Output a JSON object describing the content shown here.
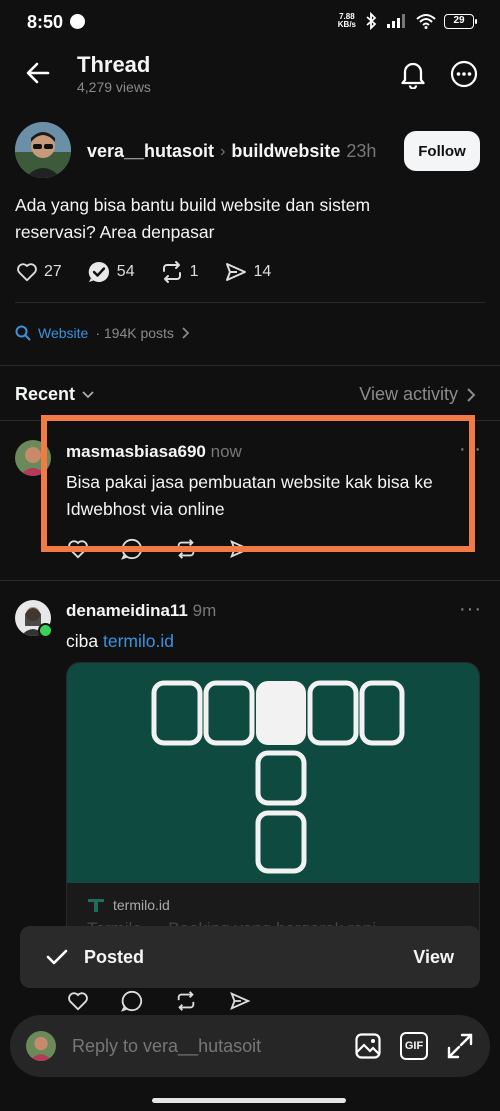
{
  "status_bar": {
    "time": "8:50",
    "net_speed": "7.88",
    "net_unit": "KB/s",
    "battery": "29"
  },
  "header": {
    "title": "Thread",
    "views": "4,279 views",
    "back_icon": "arrow-left-icon",
    "bell_icon": "bell-icon",
    "more_icon": "more-circle-icon"
  },
  "post": {
    "author": "vera__hutasoit",
    "separator": "›",
    "community": "buildwebsite",
    "time": "23h",
    "follow_label": "Follow",
    "text": "Ada yang bisa bantu build website dan sistem reservasi? Area denpasar",
    "likes": "27",
    "checks": "54",
    "reposts": "1",
    "shares": "14"
  },
  "topic": {
    "name": "Website",
    "count": "· 194K posts"
  },
  "replies_header": {
    "sort_label": "Recent",
    "activity_label": "View activity"
  },
  "replies": [
    {
      "author": "masmasbiasa690",
      "time": "now",
      "text": "Bisa pakai jasa pembuatan website kak bisa ke Idwebhost via online"
    },
    {
      "author": "denameidina11",
      "time": "9m",
      "text_prefix": "ciba ",
      "link": "termilo.id",
      "card": {
        "domain": "termilo.id",
        "title": "Termilo — Booking yang bergerak rapi"
      }
    }
  ],
  "toast": {
    "label": "Posted",
    "action": "View"
  },
  "composer": {
    "placeholder": "Reply to vera__hutasoit",
    "gif_label": "GIF"
  },
  "colors": {
    "accent_link": "#3b93e0",
    "highlight": "#f17a45",
    "card_bg": "#0e4a40",
    "online": "#3ad15a"
  }
}
